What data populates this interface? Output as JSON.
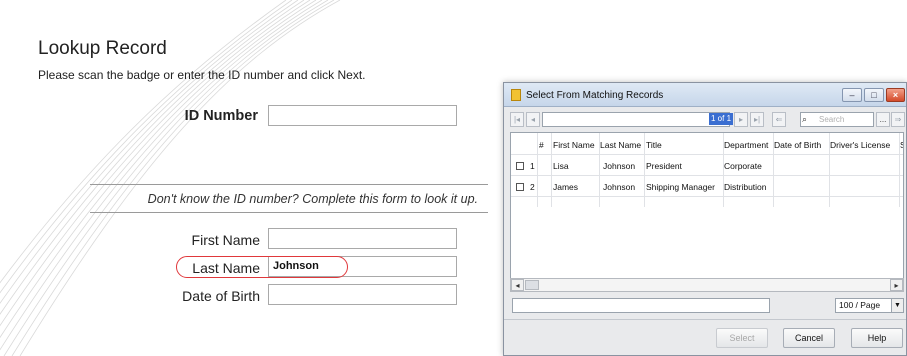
{
  "lookup": {
    "title": "Lookup Record",
    "instruction": "Please scan the badge or enter the ID number and click Next.",
    "id_label": "ID Number",
    "id_value": "",
    "hint": "Don't know the ID number? Complete this form to look it up.",
    "first_name_label": "First Name",
    "first_name_value": "",
    "last_name_label": "Last Name",
    "last_name_value": "Johnson",
    "dob_label": "Date of Birth",
    "dob_value": ""
  },
  "dialog": {
    "title": "Select From Matching Records",
    "pager": "1 of 1",
    "search_placeholder": "Search",
    "columns": [
      "#",
      "First Name",
      "Last Name",
      "Title",
      "Department",
      "Date of Birth",
      "Driver's License",
      "S"
    ],
    "rows": [
      {
        "num": "1",
        "first": "Lisa",
        "last": "Johnson",
        "title": "President",
        "dept": "Corporate",
        "dob": "",
        "license": ""
      },
      {
        "num": "2",
        "first": "James",
        "last": "Johnson",
        "title": "Shipping Manager",
        "dept": "Distribution",
        "dob": "",
        "license": ""
      }
    ],
    "page_size": "100 / Page",
    "buttons": {
      "select": "Select",
      "cancel": "Cancel",
      "help": "Help"
    },
    "more_button": "...",
    "scroll_left": "◂",
    "scroll_right": "▸",
    "icons": [
      "first-page-icon",
      "prev-page-icon",
      "next-page-icon",
      "last-page-icon",
      "back-icon",
      "binoculars-icon",
      "forward-icon",
      "minimize-icon",
      "maximize-icon",
      "close-icon"
    ]
  },
  "colors": {
    "highlight_oval": "#e0383b",
    "pager_bg": "#3a6ed1"
  }
}
